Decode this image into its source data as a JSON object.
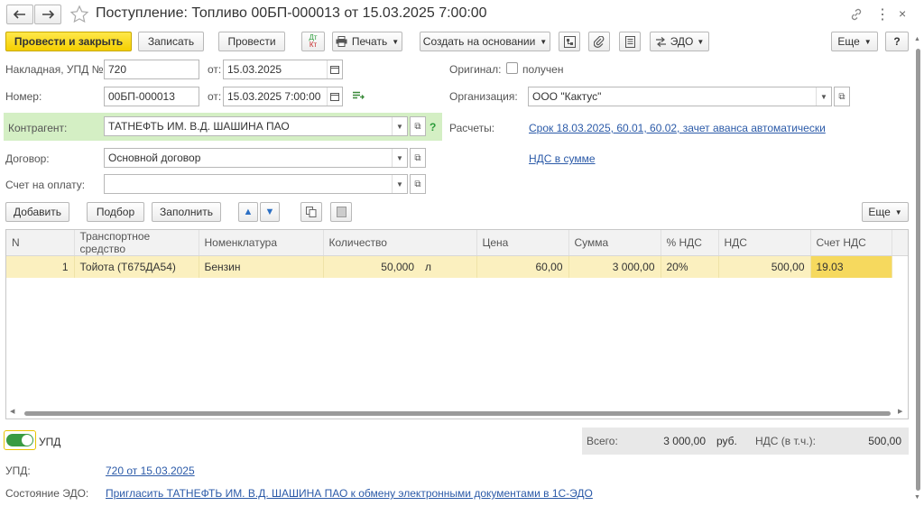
{
  "window": {
    "title": "Поступление: Топливо 00БП-000013 от 15.03.2025 7:00:00"
  },
  "toolbar": {
    "post_close": "Провести и закрыть",
    "save": "Записать",
    "post": "Провести",
    "dtkt": "Дт Кт",
    "print": "Печать",
    "create_based": "Создать на основании",
    "edo": "ЭДО",
    "more": "Еще",
    "help": "?"
  },
  "form": {
    "invoice_label": "Накладная, УПД №:",
    "invoice_value": "720",
    "from_label": "от:",
    "invoice_date": "15.03.2025",
    "number_label": "Номер:",
    "number_value": "00БП-000013",
    "number_date": "15.03.2025  7:00:00",
    "original_label": "Оригинал:",
    "original_checkbox": "получен",
    "org_label": "Организация:",
    "org_value": "ООО \"Кактус\"",
    "contractor_label": "Контрагент:",
    "contractor_value": "ТАТНЕФТЬ ИМ. В.Д. ШАШИНА ПАО",
    "calc_label": "Расчеты:",
    "calc_link": "Срок 18.03.2025, 60.01, 60.02, зачет аванса автоматически",
    "contract_label": "Договор:",
    "contract_value": "Основной договор",
    "vat_link": "НДС в сумме",
    "payment_label": "Счет на оплату:",
    "payment_value": ""
  },
  "table_toolbar": {
    "add": "Добавить",
    "select": "Подбор",
    "fill": "Заполнить",
    "more": "Еще"
  },
  "table": {
    "columns": [
      "N",
      "Транспортное средство",
      "Номенклатура",
      "Количество",
      "",
      "Цена",
      "Сумма",
      "% НДС",
      "НДС",
      "Счет НДС"
    ],
    "rows": [
      [
        "1",
        "Тойота (Т675ДА54)",
        "Бензин",
        "50,000",
        "л",
        "60,00",
        "3 000,00",
        "20%",
        "500,00",
        "19.03"
      ]
    ]
  },
  "footer": {
    "upd_toggle": "УПД",
    "total_label": "Всего:",
    "total_value": "3 000,00",
    "currency": "руб.",
    "vat_label": "НДС (в т.ч.):",
    "vat_value": "500,00",
    "upd_label": "УПД:",
    "upd_link": "720 от 15.03.2025",
    "edo_label": "Состояние ЭДО:",
    "edo_link": "Пригласить ТАТНЕФТЬ ИМ. В.Д. ШАШИНА ПАО к обмену электронными документами в 1С-ЭДО"
  },
  "colors": {
    "primary_button": "#f5cf00",
    "contractor_highlight": "#d4efc4",
    "selected_row": "#fbf0bf",
    "link": "#2b5aa8",
    "toggle": "#3a9b42"
  }
}
